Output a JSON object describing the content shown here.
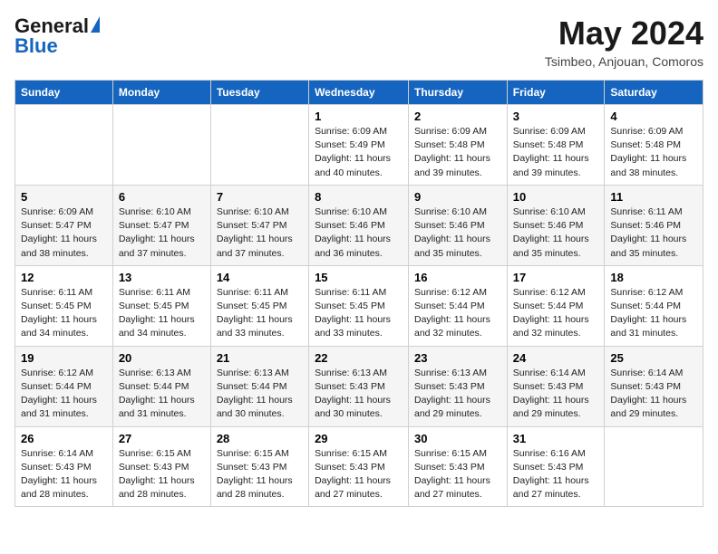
{
  "header": {
    "logo_general": "General",
    "logo_blue": "Blue",
    "title": "May 2024",
    "location": "Tsimbeo, Anjouan, Comoros"
  },
  "columns": [
    "Sunday",
    "Monday",
    "Tuesday",
    "Wednesday",
    "Thursday",
    "Friday",
    "Saturday"
  ],
  "weeks": [
    [
      {
        "day": "",
        "info": ""
      },
      {
        "day": "",
        "info": ""
      },
      {
        "day": "",
        "info": ""
      },
      {
        "day": "1",
        "info": "Sunrise: 6:09 AM\nSunset: 5:49 PM\nDaylight: 11 hours and 40 minutes."
      },
      {
        "day": "2",
        "info": "Sunrise: 6:09 AM\nSunset: 5:48 PM\nDaylight: 11 hours and 39 minutes."
      },
      {
        "day": "3",
        "info": "Sunrise: 6:09 AM\nSunset: 5:48 PM\nDaylight: 11 hours and 39 minutes."
      },
      {
        "day": "4",
        "info": "Sunrise: 6:09 AM\nSunset: 5:48 PM\nDaylight: 11 hours and 38 minutes."
      }
    ],
    [
      {
        "day": "5",
        "info": "Sunrise: 6:09 AM\nSunset: 5:47 PM\nDaylight: 11 hours and 38 minutes."
      },
      {
        "day": "6",
        "info": "Sunrise: 6:10 AM\nSunset: 5:47 PM\nDaylight: 11 hours and 37 minutes."
      },
      {
        "day": "7",
        "info": "Sunrise: 6:10 AM\nSunset: 5:47 PM\nDaylight: 11 hours and 37 minutes."
      },
      {
        "day": "8",
        "info": "Sunrise: 6:10 AM\nSunset: 5:46 PM\nDaylight: 11 hours and 36 minutes."
      },
      {
        "day": "9",
        "info": "Sunrise: 6:10 AM\nSunset: 5:46 PM\nDaylight: 11 hours and 35 minutes."
      },
      {
        "day": "10",
        "info": "Sunrise: 6:10 AM\nSunset: 5:46 PM\nDaylight: 11 hours and 35 minutes."
      },
      {
        "day": "11",
        "info": "Sunrise: 6:11 AM\nSunset: 5:46 PM\nDaylight: 11 hours and 35 minutes."
      }
    ],
    [
      {
        "day": "12",
        "info": "Sunrise: 6:11 AM\nSunset: 5:45 PM\nDaylight: 11 hours and 34 minutes."
      },
      {
        "day": "13",
        "info": "Sunrise: 6:11 AM\nSunset: 5:45 PM\nDaylight: 11 hours and 34 minutes."
      },
      {
        "day": "14",
        "info": "Sunrise: 6:11 AM\nSunset: 5:45 PM\nDaylight: 11 hours and 33 minutes."
      },
      {
        "day": "15",
        "info": "Sunrise: 6:11 AM\nSunset: 5:45 PM\nDaylight: 11 hours and 33 minutes."
      },
      {
        "day": "16",
        "info": "Sunrise: 6:12 AM\nSunset: 5:44 PM\nDaylight: 11 hours and 32 minutes."
      },
      {
        "day": "17",
        "info": "Sunrise: 6:12 AM\nSunset: 5:44 PM\nDaylight: 11 hours and 32 minutes."
      },
      {
        "day": "18",
        "info": "Sunrise: 6:12 AM\nSunset: 5:44 PM\nDaylight: 11 hours and 31 minutes."
      }
    ],
    [
      {
        "day": "19",
        "info": "Sunrise: 6:12 AM\nSunset: 5:44 PM\nDaylight: 11 hours and 31 minutes."
      },
      {
        "day": "20",
        "info": "Sunrise: 6:13 AM\nSunset: 5:44 PM\nDaylight: 11 hours and 31 minutes."
      },
      {
        "day": "21",
        "info": "Sunrise: 6:13 AM\nSunset: 5:44 PM\nDaylight: 11 hours and 30 minutes."
      },
      {
        "day": "22",
        "info": "Sunrise: 6:13 AM\nSunset: 5:43 PM\nDaylight: 11 hours and 30 minutes."
      },
      {
        "day": "23",
        "info": "Sunrise: 6:13 AM\nSunset: 5:43 PM\nDaylight: 11 hours and 29 minutes."
      },
      {
        "day": "24",
        "info": "Sunrise: 6:14 AM\nSunset: 5:43 PM\nDaylight: 11 hours and 29 minutes."
      },
      {
        "day": "25",
        "info": "Sunrise: 6:14 AM\nSunset: 5:43 PM\nDaylight: 11 hours and 29 minutes."
      }
    ],
    [
      {
        "day": "26",
        "info": "Sunrise: 6:14 AM\nSunset: 5:43 PM\nDaylight: 11 hours and 28 minutes."
      },
      {
        "day": "27",
        "info": "Sunrise: 6:15 AM\nSunset: 5:43 PM\nDaylight: 11 hours and 28 minutes."
      },
      {
        "day": "28",
        "info": "Sunrise: 6:15 AM\nSunset: 5:43 PM\nDaylight: 11 hours and 28 minutes."
      },
      {
        "day": "29",
        "info": "Sunrise: 6:15 AM\nSunset: 5:43 PM\nDaylight: 11 hours and 27 minutes."
      },
      {
        "day": "30",
        "info": "Sunrise: 6:15 AM\nSunset: 5:43 PM\nDaylight: 11 hours and 27 minutes."
      },
      {
        "day": "31",
        "info": "Sunrise: 6:16 AM\nSunset: 5:43 PM\nDaylight: 11 hours and 27 minutes."
      },
      {
        "day": "",
        "info": ""
      }
    ]
  ]
}
